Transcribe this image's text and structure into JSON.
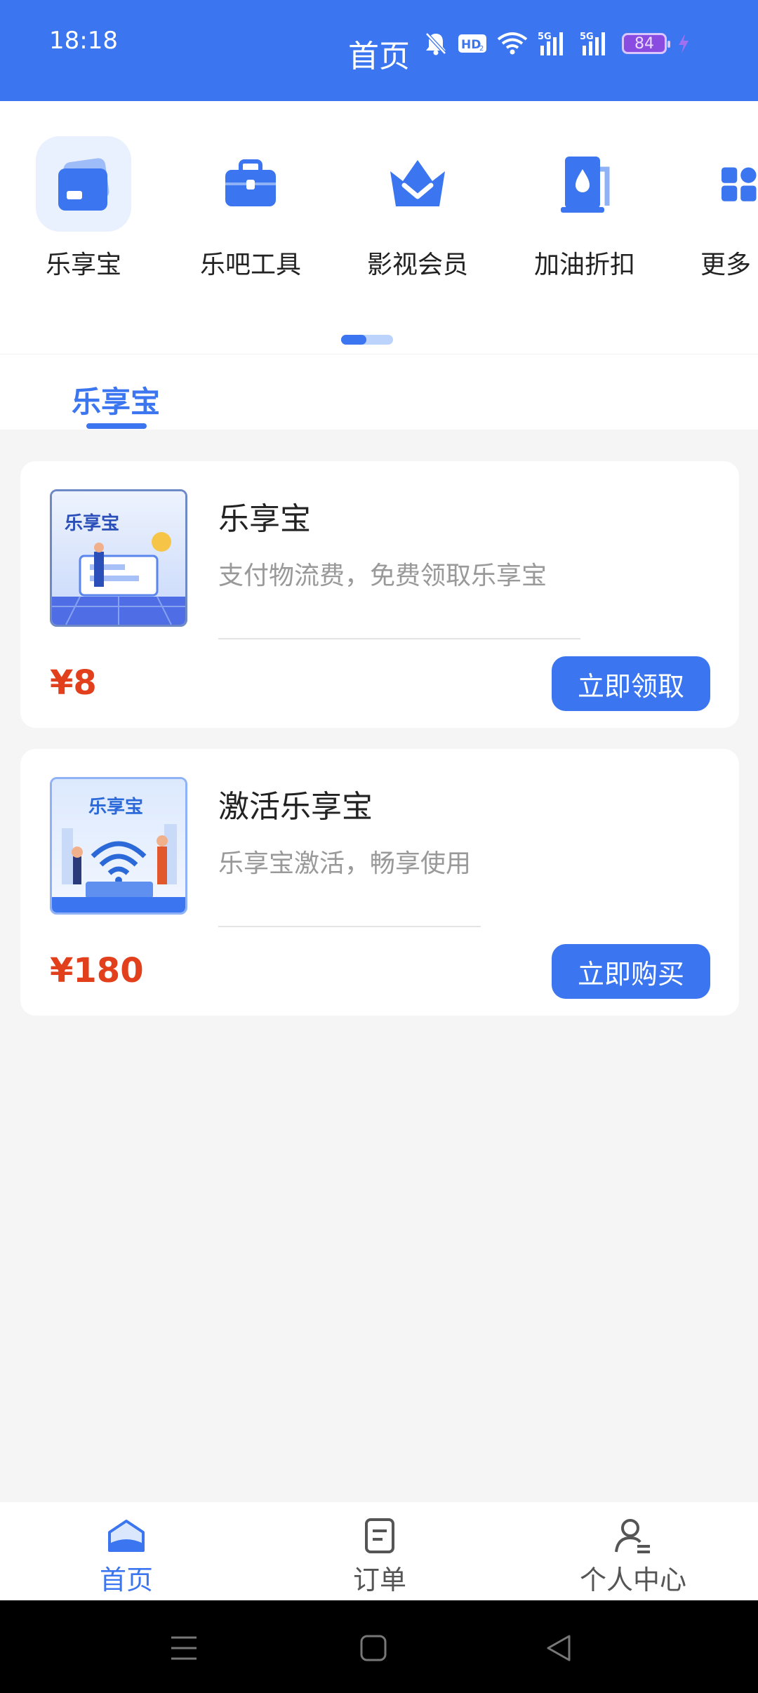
{
  "status_bar": {
    "time": "18:18",
    "title": "首页",
    "battery": "84",
    "icons": [
      "bell-muted-icon",
      "hd-icon",
      "wifi-icon",
      "signal-5g-icon",
      "signal-5g-icon",
      "battery-icon",
      "charging-icon"
    ]
  },
  "quick_menu": {
    "items": [
      {
        "label": "乐享宝",
        "icon": "card-icon",
        "active": true
      },
      {
        "label": "乐吧工具",
        "icon": "toolbox-icon",
        "active": false
      },
      {
        "label": "影视会员",
        "icon": "crown-icon",
        "active": false
      },
      {
        "label": "加油折扣",
        "icon": "fuel-icon",
        "active": false
      },
      {
        "label": "更多",
        "icon": "grid-icon",
        "active": false
      }
    ],
    "page_index": 0,
    "page_count": 2
  },
  "tabs": {
    "active": "乐享宝"
  },
  "products": [
    {
      "title": "乐享宝",
      "description": "支付物流费，免费领取乐享宝",
      "price": "¥8",
      "button": "立即领取",
      "thumb_text": "乐享宝"
    },
    {
      "title": "激活乐享宝",
      "description": "乐享宝激活，畅享使用",
      "price": "¥180",
      "button": "立即购买",
      "thumb_text": "乐享宝"
    }
  ],
  "bottom_nav": {
    "items": [
      {
        "label": "首页",
        "icon": "home-icon",
        "active": true
      },
      {
        "label": "订单",
        "icon": "order-icon",
        "active": false
      },
      {
        "label": "个人中心",
        "icon": "profile-icon",
        "active": false
      }
    ]
  },
  "colors": {
    "primary": "#3b76f0",
    "price": "#e2401c",
    "background": "#f5f5f6"
  }
}
